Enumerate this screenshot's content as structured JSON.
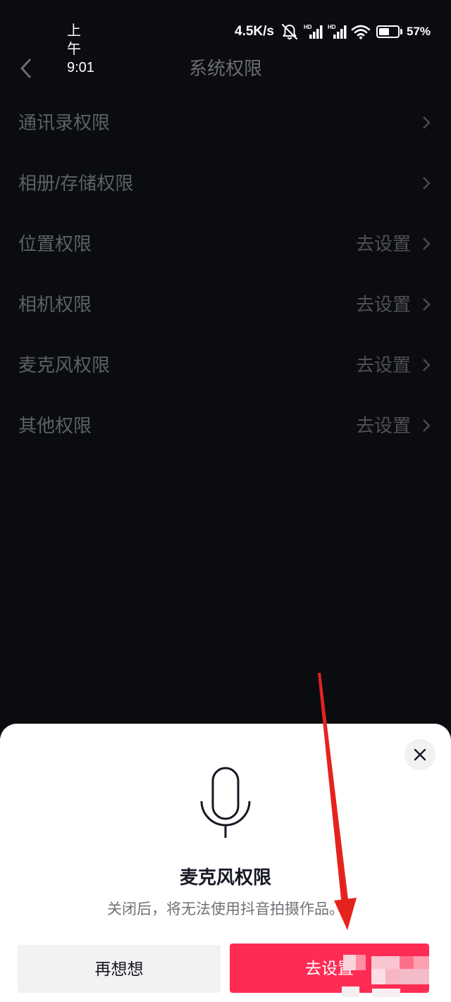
{
  "status_bar": {
    "time": "上午9:01",
    "net_speed": "4.5K/s",
    "sim1_badge": "HD",
    "sim2_badge": "HD",
    "battery_text": "57%",
    "battery_level": 57,
    "icons": [
      "mute-bell-icon",
      "signal-icon",
      "signal-icon",
      "wifi-icon",
      "battery-icon"
    ]
  },
  "header": {
    "back_icon": "chevron-left-icon",
    "title": "系统权限"
  },
  "permissions": [
    {
      "label": "通讯录权限",
      "icon": "chevron-right-icon"
    },
    {
      "label": "相册/存储权限",
      "icon": "chevron-right-icon"
    },
    {
      "label": "位置权限",
      "action": "去设置",
      "icon": "chevron-right-icon"
    },
    {
      "label": "相机权限",
      "action": "去设置",
      "icon": "chevron-right-icon"
    },
    {
      "label": "麦克风权限",
      "action": "去设置",
      "icon": "chevron-right-icon"
    },
    {
      "label": "其他权限",
      "action": "去设置",
      "icon": "chevron-right-icon"
    }
  ],
  "permission_sheet": {
    "close_icon": "close-icon",
    "icon": "microphone-icon",
    "title": "麦克风权限",
    "description": "关闭后，将无法使用抖音拍摄作品。",
    "cancel_label": "再想想",
    "confirm_label": "去设置"
  },
  "colors": {
    "accent": "#fe2c55",
    "annotation_arrow": "#e5231e"
  }
}
